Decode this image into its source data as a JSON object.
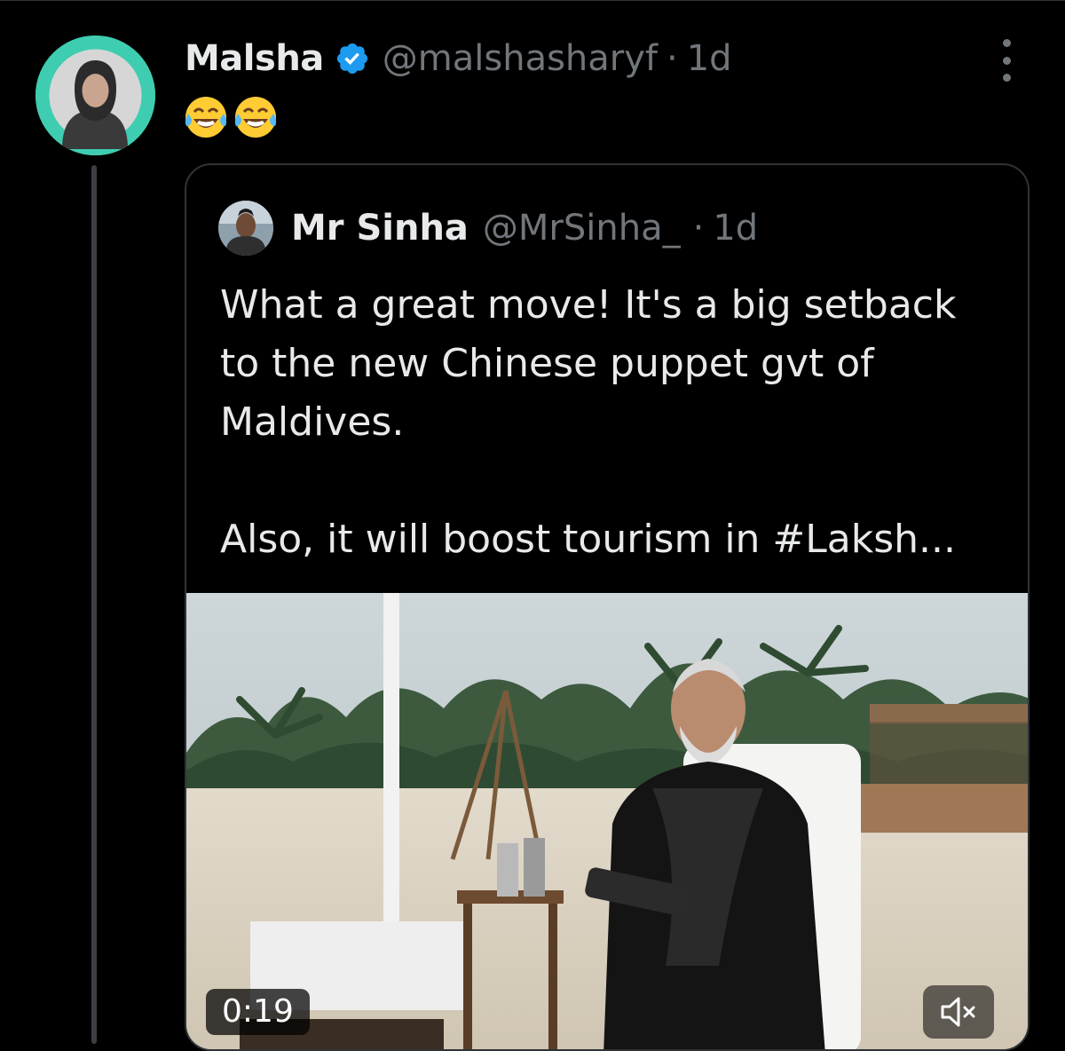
{
  "author": {
    "display_name": "Malsha",
    "handle": "@malshasharyf",
    "separator": "·",
    "time": "1d",
    "verified": true
  },
  "post": {
    "emojis": [
      "😂",
      "😂"
    ]
  },
  "quoted_post": {
    "display_name": "Mr Sinha",
    "handle": "@MrSinha_",
    "separator": "·",
    "time": "1d",
    "text": "What a great move! It's a big setback to the new Chinese puppet gvt of Maldives.\n\nAlso, it will boost tourism in #Laksh..."
  },
  "video": {
    "duration": "0:19",
    "muted": true
  },
  "colors": {
    "background": "#000000",
    "text_primary": "#e7e9ea",
    "text_secondary": "#71767b",
    "border": "#2f3336",
    "verified_blue": "#1d9bf0",
    "avatar_bg": "#3fcdb1"
  },
  "icons": {
    "verified": "verified-badge-icon",
    "more": "more-dots-icon",
    "mute": "speaker-muted-icon"
  }
}
